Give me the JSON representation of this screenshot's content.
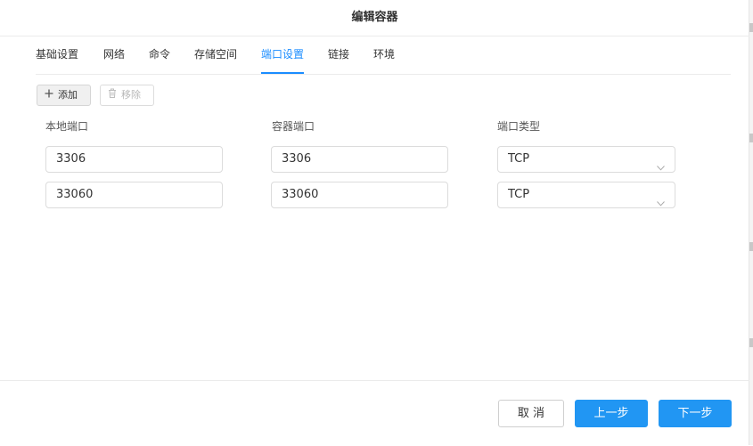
{
  "dialog": {
    "title": "编辑容器"
  },
  "tabs": [
    {
      "label": "基础设置"
    },
    {
      "label": "网络"
    },
    {
      "label": "命令"
    },
    {
      "label": "存储空间"
    },
    {
      "label": "端口设置",
      "active": true
    },
    {
      "label": "链接"
    },
    {
      "label": "环境"
    }
  ],
  "toolbar": {
    "add_label": "添加",
    "remove_label": "移除"
  },
  "columns": {
    "local_port": "本地端口",
    "container_port": "容器端口",
    "port_type": "端口类型"
  },
  "rows": [
    {
      "local_port": "3306",
      "container_port": "3306",
      "type": "TCP"
    },
    {
      "local_port": "33060",
      "container_port": "33060",
      "type": "TCP"
    }
  ],
  "footer": {
    "cancel_label": "取 消",
    "prev_label": "上一步",
    "next_label": "下一步"
  },
  "colors": {
    "accent": "#1a8cff",
    "primary_button": "#2196f3"
  },
  "icons": {
    "add": "plus-icon",
    "remove": "trash-icon",
    "select": "chevron-down-icon"
  }
}
